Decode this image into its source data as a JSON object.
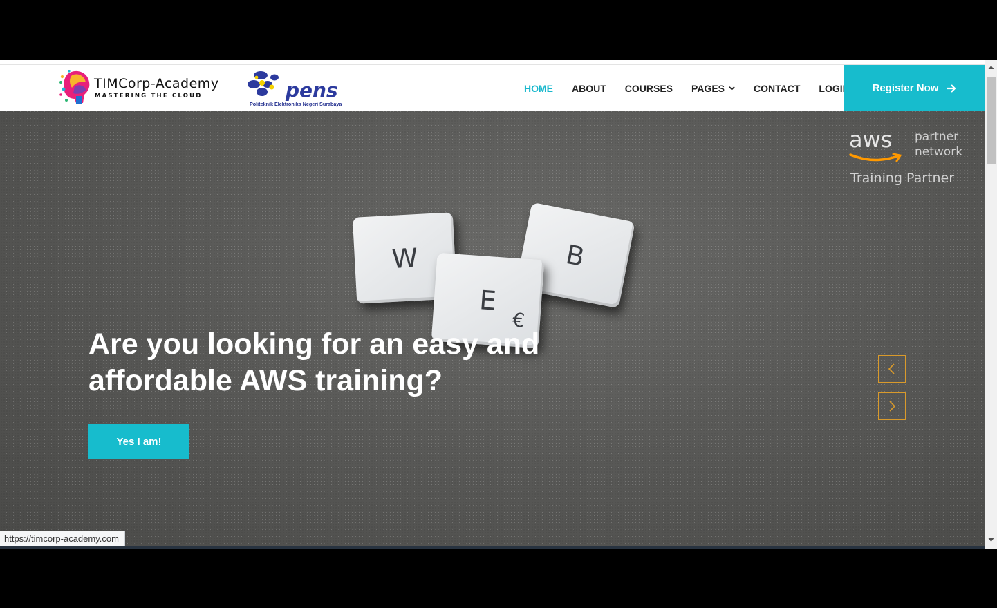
{
  "header": {
    "brand_name": "TIMCorp-Academy",
    "brand_tagline": "MASTERING THE CLOUD",
    "partner_logo_text": "pens",
    "partner_logo_subtitle": "Politeknik Elektronika Negeri Surabaya",
    "nav": [
      {
        "label": "HOME",
        "active": true
      },
      {
        "label": "ABOUT",
        "active": false
      },
      {
        "label": "COURSES",
        "active": false
      },
      {
        "label": "PAGES",
        "active": false,
        "dropdown": true
      },
      {
        "label": "CONTACT",
        "active": false
      },
      {
        "label": "LOGIN",
        "active": false
      }
    ],
    "register_label": "Register Now",
    "accent_color": "#17bccd"
  },
  "hero": {
    "tiles": [
      "W",
      "E",
      "B"
    ],
    "tile_symbol": "€",
    "headline": "Are you looking for an easy and affordable AWS training?",
    "cta_label": "Yes I am!",
    "badge": {
      "logo": "aws",
      "line1": "partner",
      "line2": "network",
      "caption": "Training Partner"
    },
    "prev_icon": "chevron-left-icon",
    "next_icon": "chevron-right-icon"
  },
  "status_url": "https://timcorp-academy.com"
}
